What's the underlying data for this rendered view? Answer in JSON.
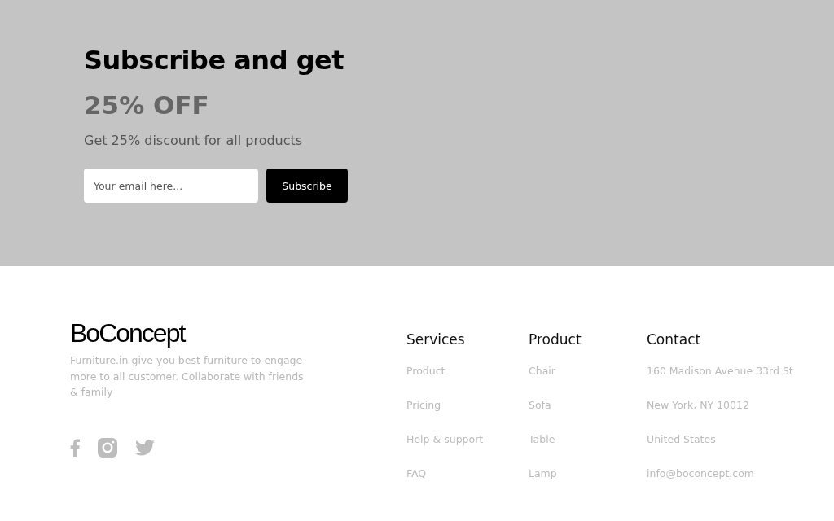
{
  "subscribe": {
    "title": "Subscribe and get",
    "offer": "25% OFF",
    "subtitle": "Get 25% discount for all products",
    "email": {
      "placeholder": "Your email here..."
    },
    "button": "Subscribe"
  },
  "footer": {
    "logo": "BoConcept",
    "description": "Furniture.in give you best furniture to engage more to all customer. Collaborate with friends & family",
    "social": [
      {
        "kind": "facebook"
      },
      {
        "kind": "instagram"
      },
      {
        "kind": "twitter"
      }
    ],
    "columns": [
      {
        "heading": "Services",
        "links": [
          "Product",
          "Pricing",
          "Help & support",
          "FAQ"
        ]
      },
      {
        "heading": "Product",
        "links": [
          "Chair",
          "Sofa",
          "Table",
          "Lamp"
        ]
      },
      {
        "heading": "Contact",
        "links": [
          "160 Madison Avenue 33rd St",
          "New York, NY 10012",
          "United States",
          "info@boconcept.com"
        ]
      }
    ]
  }
}
